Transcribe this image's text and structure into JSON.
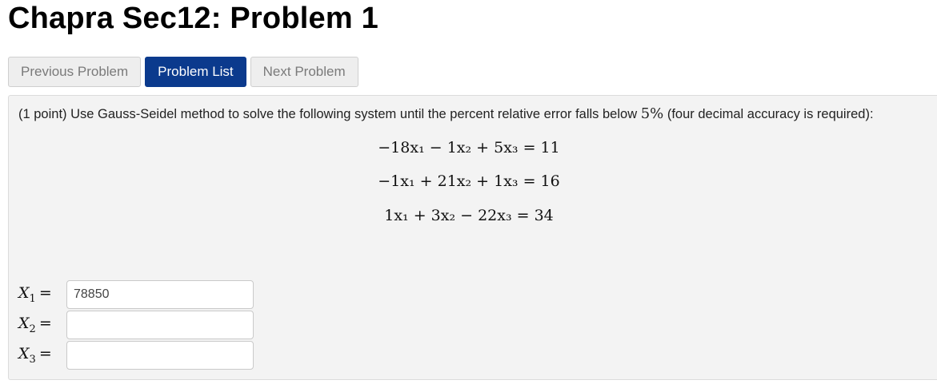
{
  "page": {
    "title": "Chapra Sec12: Problem 1"
  },
  "nav": {
    "previous_label": "Previous Problem",
    "list_label": "Problem List",
    "next_label": "Next Problem"
  },
  "problem": {
    "prompt_prefix": "(1 point) Use Gauss-Seidel method to solve the following system until the percent relative error falls below ",
    "error_threshold": "5%",
    "prompt_suffix": " (four decimal accuracy is required):",
    "equations": [
      "−18x₁ − 1x₂ + 5x₃ = 11",
      "−1x₁ + 21x₂ + 1x₃ = 16",
      "1x₁ + 3x₂ − 22x₃ = 34"
    ]
  },
  "answers": [
    {
      "var": "X",
      "sub": "1",
      "value": "78850"
    },
    {
      "var": "X",
      "sub": "2",
      "value": ""
    },
    {
      "var": "X",
      "sub": "3",
      "value": ""
    }
  ],
  "colors": {
    "primary_button": "#0b3a8d",
    "panel_background": "#f3f3f3"
  }
}
